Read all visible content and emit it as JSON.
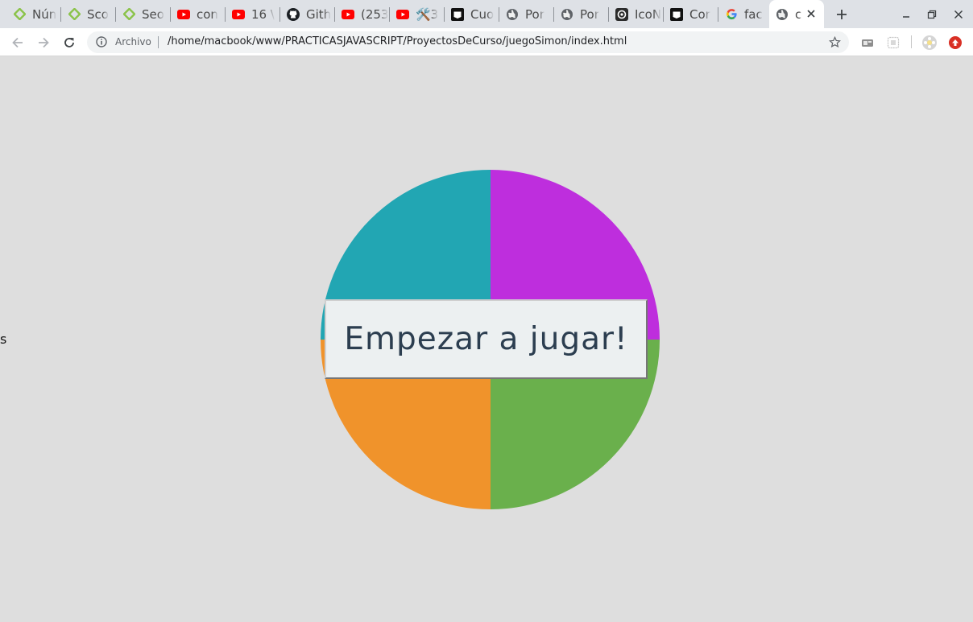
{
  "browser": {
    "tabs": [
      {
        "title": "Nún",
        "icon": "green-diamond-icon"
      },
      {
        "title": "Sco",
        "icon": "green-diamond-icon"
      },
      {
        "title": "Seo",
        "icon": "green-diamond-icon"
      },
      {
        "title": "con",
        "icon": "youtube-icon"
      },
      {
        "title": "16 \\",
        "icon": "youtube-icon"
      },
      {
        "title": "Gith",
        "icon": "github-icon"
      },
      {
        "title": "(253",
        "icon": "youtube-icon"
      },
      {
        "title": "🛠️3",
        "icon": "youtube-icon"
      },
      {
        "title": "Cuo",
        "icon": "codepen-icon"
      },
      {
        "title": "Por",
        "icon": "globe-icon"
      },
      {
        "title": "Por",
        "icon": "globe-icon"
      },
      {
        "title": "IcoN",
        "icon": "icomoon-icon"
      },
      {
        "title": "Cor",
        "icon": "codepen-icon"
      },
      {
        "title": "fac",
        "icon": "google-icon"
      },
      {
        "title": "c",
        "icon": "globe-icon",
        "active": true
      }
    ],
    "omnibox": {
      "scheme_label": "Archivo",
      "url": "/home/macbook/www/PRACTICASJAVASCRIPT/ProyectosDeCurso/juegoSimon/index.html"
    }
  },
  "page": {
    "side_text": "s",
    "start_button_label": "Empezar a jugar!",
    "colors": {
      "celeste": "#22a6b3",
      "violeta": "#be2edd",
      "naranja": "#f0932b",
      "verde": "#6ab04c",
      "background": "#dedede"
    }
  }
}
